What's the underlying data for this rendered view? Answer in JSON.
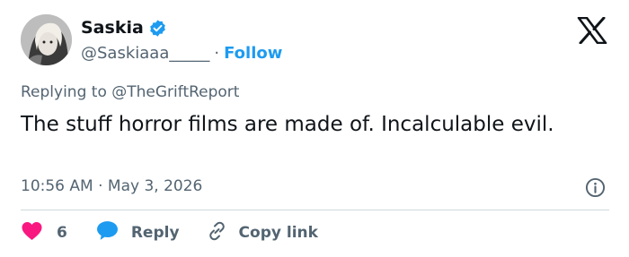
{
  "author": {
    "name": "Saskia",
    "handle": "@Saskiaaa_____",
    "separator": "·",
    "follow_label": "Follow"
  },
  "tweet": {
    "replying_prefix": "Replying to",
    "replying_handle": "@TheGriftReport",
    "text": "The stuff horror films are made of. Incalculable evil.",
    "timestamp": "10:56 AM · May 3, 2026"
  },
  "actions": {
    "like_count": "6",
    "reply_label": "Reply",
    "copy_link_label": "Copy link"
  },
  "colors": {
    "accent": "#1d9bf0",
    "like": "#f91880",
    "muted": "#536471",
    "text": "#0f1419",
    "divider": "#cfd9de"
  },
  "icons": [
    "verified-badge-icon",
    "x-logo-icon",
    "info-icon",
    "heart-icon",
    "speech-bubble-icon",
    "link-icon"
  ]
}
